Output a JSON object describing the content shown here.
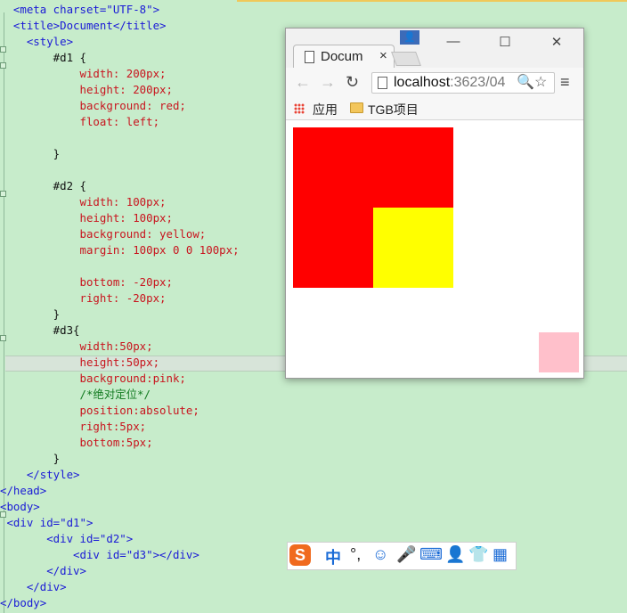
{
  "editor": {
    "lines": [
      "  <meta charset=\"UTF-8\">",
      "  <title>Document</title>",
      "    <style>",
      "        #d1 {",
      "            width: 200px;",
      "            height: 200px;",
      "            background: red;",
      "            float: left;",
      "",
      "        }",
      "",
      "        #d2 {",
      "            width: 100px;",
      "            height: 100px;",
      "            background: yellow;",
      "            margin: 100px 0 0 100px;",
      "",
      "            bottom: -20px;",
      "            right: -20px;",
      "        }",
      "        #d3{",
      "            width:50px;",
      "            height:50px;",
      "            background:pink;",
      "            /*绝对定位*/",
      "            position:absolute;",
      "            right:5px;",
      "            bottom:5px;",
      "        }",
      "    </style>",
      "</head>",
      "<body>",
      " <div id=\"d1\">",
      "       <div id=\"d2\">",
      "           <div id=\"d3\"></div>",
      "       </div>",
      "    </div>",
      "</body>"
    ]
  },
  "browser": {
    "tab_title": "Docum",
    "tab_close": "×",
    "user_icon": "👤",
    "minimize": "—",
    "maximize": "☐",
    "close": "✕",
    "back": "←",
    "forward": "→",
    "reload": "↻",
    "url_host": "localhost",
    "url_rest": ":3623/04",
    "zoom": "🔍",
    "star": "☆",
    "menu": "≡",
    "bookmark_apps": "应用",
    "bookmark_folder": "TGB项目",
    "colors": {
      "d1": "#ff0000",
      "d2": "#ffff00",
      "d3": "#ffc0cb"
    }
  },
  "ime": {
    "logo": "S",
    "items": [
      "中",
      "°,",
      "☺",
      "🎤",
      "⌨",
      "👤",
      "👕",
      "▦"
    ]
  }
}
